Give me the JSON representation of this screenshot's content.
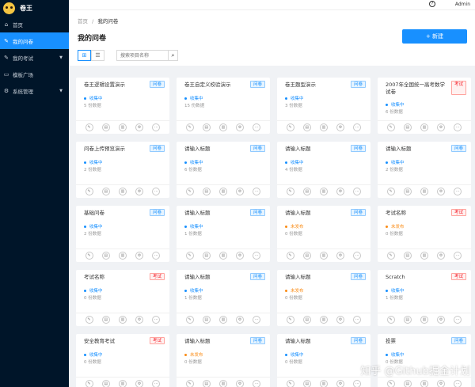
{
  "app": {
    "name": "卷王"
  },
  "sidebar": {
    "items": [
      {
        "label": "首页",
        "icon": "home-icon"
      },
      {
        "label": "我的问卷",
        "icon": "edit-icon",
        "active": true
      },
      {
        "label": "我的考试",
        "icon": "exam-icon",
        "expandable": true
      },
      {
        "label": "模板广场",
        "icon": "template-icon"
      },
      {
        "label": "系统管理",
        "icon": "settings-icon",
        "expandable": true
      }
    ]
  },
  "topbar": {
    "user": "Admin"
  },
  "header": {
    "breadcrumb_home": "首页",
    "breadcrumb_sep": "/",
    "breadcrumb_current": "我的问卷",
    "title": "我的问卷",
    "new_button": "+ 新建",
    "search_placeholder": "搜索项目名称"
  },
  "cards": [
    {
      "title": "卷王逻辑设置演示",
      "tag": "问卷",
      "status": "收集中",
      "count": "5 份数据"
    },
    {
      "title": "卷王自定义校验演示",
      "tag": "问卷",
      "status": "收集中",
      "count": "15 份数据"
    },
    {
      "title": "卷王题型演示",
      "tag": "问卷",
      "status": "收集中",
      "count": "3 份数据"
    },
    {
      "title": "2007年全国统一高考数学试卷",
      "tag": "考试",
      "status": "收集中",
      "count": "6 份数据"
    },
    {
      "title": "问卷上传预览演示",
      "tag": "问卷",
      "status": "收集中",
      "count": "2 份数据"
    },
    {
      "title": "请输入标题",
      "tag": "问卷",
      "status": "收集中",
      "count": "6 份数据"
    },
    {
      "title": "请输入标题",
      "tag": "问卷",
      "status": "收集中",
      "count": "4 份数据"
    },
    {
      "title": "请输入标题",
      "tag": "问卷",
      "status": "收集中",
      "count": "2 份数据"
    },
    {
      "title": "基础问卷",
      "tag": "问卷",
      "status": "收集中",
      "count": "2 份数据"
    },
    {
      "title": "请输入标题",
      "tag": "问卷",
      "status": "收集中",
      "count": "1 份数据"
    },
    {
      "title": "请输入标题",
      "tag": "问卷",
      "status": "未发布",
      "count": "0 份数据"
    },
    {
      "title": "考试名称",
      "tag": "考试",
      "status": "未发布",
      "count": "0 份数据"
    },
    {
      "title": "考试名称",
      "tag": "考试",
      "status": "收集中",
      "count": "0 份数据"
    },
    {
      "title": "请输入标题",
      "tag": "问卷",
      "status": "收集中",
      "count": "1 份数据"
    },
    {
      "title": "请输入标题",
      "tag": "问卷",
      "status": "未发布",
      "count": "0 份数据"
    },
    {
      "title": "Scratch",
      "tag": "考试",
      "status": "收集中",
      "count": "1 份数据"
    },
    {
      "title": "安全教育考试",
      "tag": "考试",
      "status": "收集中",
      "count": "0 份数据"
    },
    {
      "title": "请输入标题",
      "tag": "问卷",
      "status": "未发布",
      "count": "0 份数据"
    },
    {
      "title": "请输入标题",
      "tag": "问卷",
      "status": "收集中",
      "count": "0 份数据"
    },
    {
      "title": "投票",
      "tag": "问卷",
      "status": "收集中",
      "count": "0 份数据"
    }
  ],
  "watermark": "知乎 @Github掘金计划",
  "colors": {
    "primary": "#1890ff",
    "sidebar": "#001529",
    "pending": "#fa8c16",
    "exam": "#f5222d"
  }
}
